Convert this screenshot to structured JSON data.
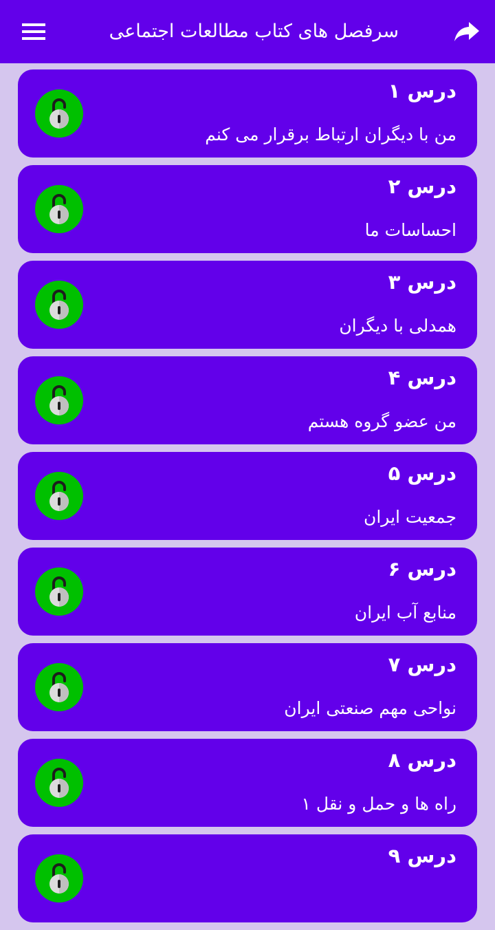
{
  "app_bar": {
    "title": "سرفصل های کتاب مطالعات اجتماعی",
    "background": "#6200ea",
    "menu_icon": "menu-icon",
    "share_icon": "share-icon"
  },
  "colors": {
    "page_background": "#d5c6ee",
    "card_background": "#6200ea",
    "lock_circle": "#00c000",
    "text": "#ffffff"
  },
  "lessons": [
    {
      "title": "درس ۱",
      "subtitle": "من با دیگران ارتباط برقرار می کنم",
      "icon": "unlocked-padlock-icon"
    },
    {
      "title": "درس ۲",
      "subtitle": "احساسات ما",
      "icon": "unlocked-padlock-icon"
    },
    {
      "title": "درس ۳",
      "subtitle": "همدلی با دیگران",
      "icon": "unlocked-padlock-icon"
    },
    {
      "title": "درس ۴",
      "subtitle": "من عضو گروه هستم",
      "icon": "unlocked-padlock-icon"
    },
    {
      "title": "درس ۵",
      "subtitle": "جمعیت ایران",
      "icon": "unlocked-padlock-icon"
    },
    {
      "title": "درس ۶",
      "subtitle": "منابع آب ایران",
      "icon": "unlocked-padlock-icon"
    },
    {
      "title": "درس ۷",
      "subtitle": "نواحی مهم صنعتی ایران",
      "icon": "unlocked-padlock-icon"
    },
    {
      "title": "درس ۸",
      "subtitle": "راه ها و حمل و نقل ۱",
      "icon": "unlocked-padlock-icon"
    },
    {
      "title": "درس ۹",
      "subtitle": "",
      "icon": "unlocked-padlock-icon"
    }
  ]
}
